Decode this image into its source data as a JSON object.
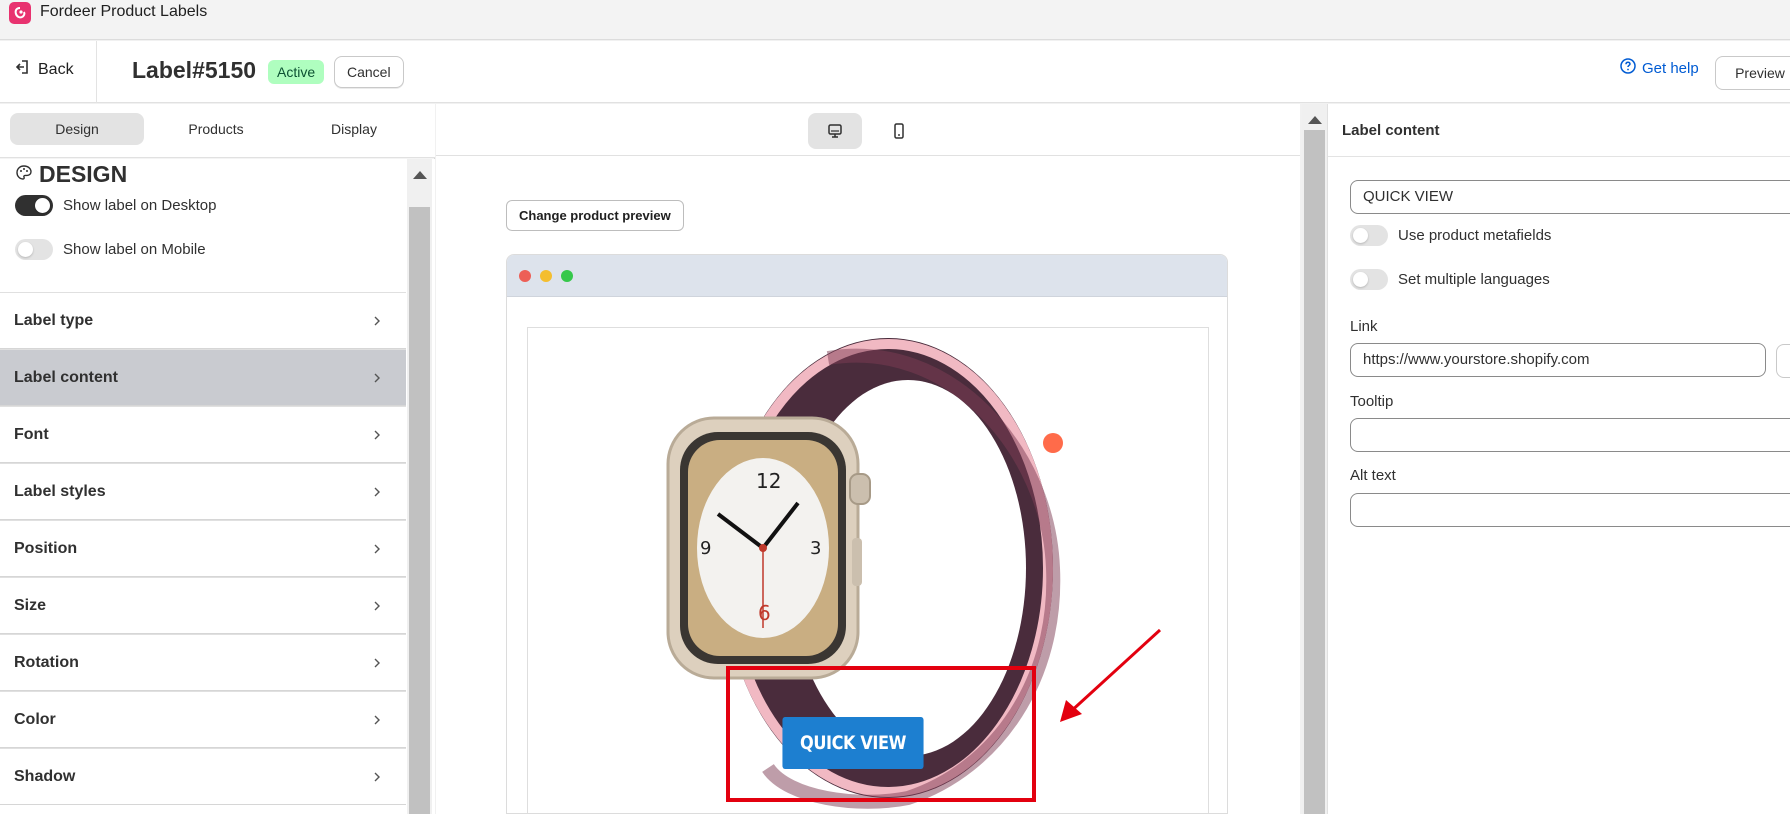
{
  "app": {
    "title": "Fordeer Product Labels"
  },
  "header": {
    "back_label": "Back",
    "title": "Label#5150",
    "status": "Active",
    "cancel_label": "Cancel",
    "help_label": "Get help",
    "preview_label": "Preview"
  },
  "tabs": [
    {
      "label": "Design",
      "active": true
    },
    {
      "label": "Products",
      "active": false
    },
    {
      "label": "Display",
      "active": false
    }
  ],
  "design": {
    "heading": "DESIGN",
    "toggles": [
      {
        "label": "Show label on Desktop",
        "on": true
      },
      {
        "label": "Show label on Mobile",
        "on": false
      }
    ],
    "sections": [
      {
        "label": "Label type",
        "active": false
      },
      {
        "label": "Label content",
        "active": true
      },
      {
        "label": "Font",
        "active": false
      },
      {
        "label": "Label styles",
        "active": false
      },
      {
        "label": "Position",
        "active": false
      },
      {
        "label": "Size",
        "active": false
      },
      {
        "label": "Rotation",
        "active": false
      },
      {
        "label": "Color",
        "active": false
      },
      {
        "label": "Shadow",
        "active": false
      }
    ]
  },
  "canvas": {
    "devices": [
      {
        "icon": "desktop-icon",
        "active": true
      },
      {
        "icon": "mobile-icon",
        "active": false
      }
    ],
    "change_preview_label": "Change product preview",
    "label_text": "QUICK VIEW",
    "label_color": "#1d7fd0",
    "highlight_color": "#e3000f"
  },
  "label_content": {
    "title": "Label content",
    "text_value": "QUICK VIEW",
    "metafields_label": "Use product metafields",
    "multi_lang_label": "Set multiple languages",
    "link_label": "Link",
    "link_value": "https://www.yourstore.shopify.com",
    "tooltip_label": "Tooltip",
    "tooltip_value": "",
    "alt_label": "Alt text",
    "alt_value": ""
  },
  "colors": {
    "brand": "#e8326f",
    "active_badge_bg": "#affebf",
    "link": "#005bd3"
  }
}
